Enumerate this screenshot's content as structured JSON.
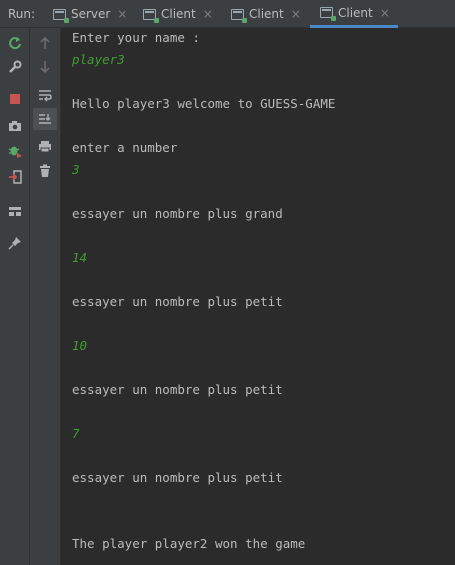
{
  "run_tabs": {
    "run_label": "Run:",
    "tabs": [
      {
        "label": "Server",
        "active": false
      },
      {
        "label": "Client",
        "active": false
      },
      {
        "label": "Client",
        "active": false
      },
      {
        "label": "Client",
        "active": true
      }
    ],
    "close_glyph": "×"
  },
  "toolbar": {
    "rerun": "rerun-icon",
    "settings": "wrench-icon",
    "stop": "stop-icon",
    "screenshot": "camera-icon",
    "debug": "bug-icon",
    "import": "import-icon",
    "layout": "layout-icon",
    "pin": "pin-icon",
    "up": "arrow-up-icon",
    "down": "arrow-down-icon",
    "soft_wrap": "soft-wrap-icon",
    "scroll_to_end": "scroll-to-end-icon",
    "print": "print-icon",
    "clear": "trash-icon"
  },
  "console": {
    "lines": [
      {
        "text": "Enter your name :",
        "kind": "out"
      },
      {
        "text": "player3",
        "kind": "inp"
      },
      {
        "text": "Hello player3 welcome to GUESS-GAME",
        "kind": "out"
      },
      {
        "text": "enter a number",
        "kind": "out"
      },
      {
        "text": "3",
        "kind": "inp"
      },
      {
        "text": "essayer un nombre plus grand",
        "kind": "out"
      },
      {
        "text": "14",
        "kind": "inp"
      },
      {
        "text": "essayer un nombre plus petit",
        "kind": "out"
      },
      {
        "text": "10",
        "kind": "inp"
      },
      {
        "text": "essayer un nombre plus petit",
        "kind": "out"
      },
      {
        "text": "7",
        "kind": "inp"
      },
      {
        "text": "essayer un nombre plus petit",
        "kind": "out"
      },
      {
        "text": "The player player2 won the game",
        "kind": "out"
      }
    ]
  },
  "colors": {
    "background": "#2b2b2b",
    "toolbar": "#3c3f41",
    "output_text": "#bbbbbb",
    "user_input": "#3d9e2e",
    "active_tab_underline": "#4a88c7"
  }
}
